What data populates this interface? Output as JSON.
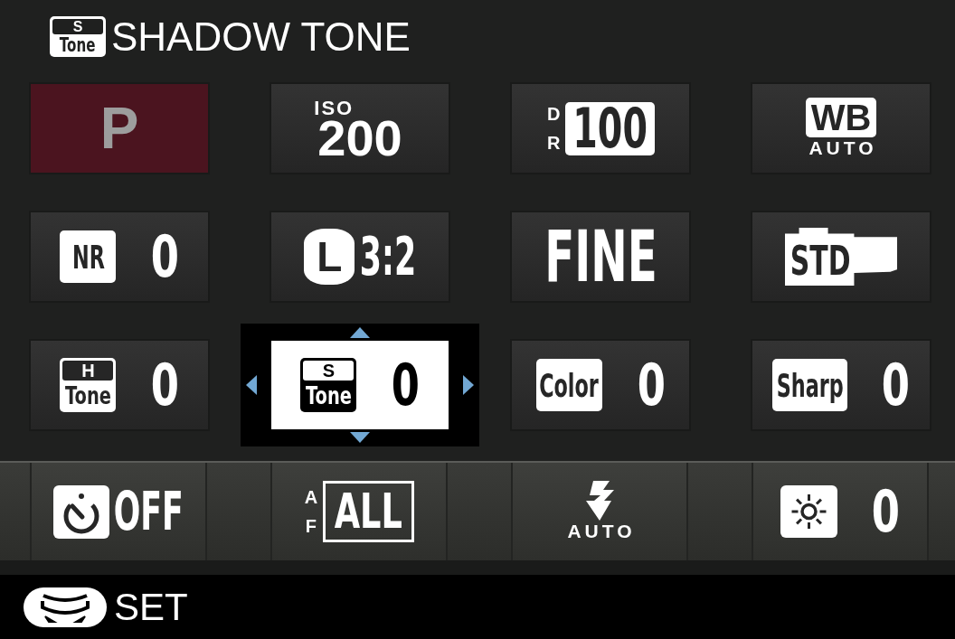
{
  "header": {
    "badge": {
      "top": "S",
      "bottom": "Tone"
    },
    "title": "SHADOW TONE"
  },
  "grid": [
    {
      "kind": "mode",
      "value": "P",
      "selected": false
    },
    {
      "kind": "iso",
      "label": "ISO",
      "value": "200",
      "selected": false
    },
    {
      "kind": "dr",
      "label": "DR",
      "value": "100",
      "selected": false
    },
    {
      "kind": "wb",
      "label": "WB",
      "value": "AUTO",
      "selected": false
    },
    {
      "kind": "badge",
      "label": "NR",
      "value": "0",
      "selected": false
    },
    {
      "kind": "size",
      "label": "L",
      "value": "3:2",
      "selected": false
    },
    {
      "kind": "text",
      "value": "FINE",
      "selected": false
    },
    {
      "kind": "film",
      "value": "STD",
      "selected": false
    },
    {
      "kind": "tone",
      "label_top": "H",
      "label_bottom": "Tone",
      "value": "0",
      "selected": false
    },
    {
      "kind": "tone",
      "label_top": "S",
      "label_bottom": "Tone",
      "value": "0",
      "selected": true
    },
    {
      "kind": "badge",
      "label": "Color",
      "value": "0",
      "selected": false
    },
    {
      "kind": "badge",
      "label": "Sharp",
      "value": "0",
      "selected": false
    }
  ],
  "bottom_row": [
    {
      "kind": "timer",
      "value": "OFF",
      "selected": false
    },
    {
      "kind": "af",
      "label": "AF",
      "value": "ALL",
      "selected": false
    },
    {
      "kind": "flash",
      "value": "AUTO",
      "selected": false
    },
    {
      "kind": "brightness",
      "value": "0",
      "selected": false
    }
  ],
  "footer": {
    "hint": "SET"
  }
}
